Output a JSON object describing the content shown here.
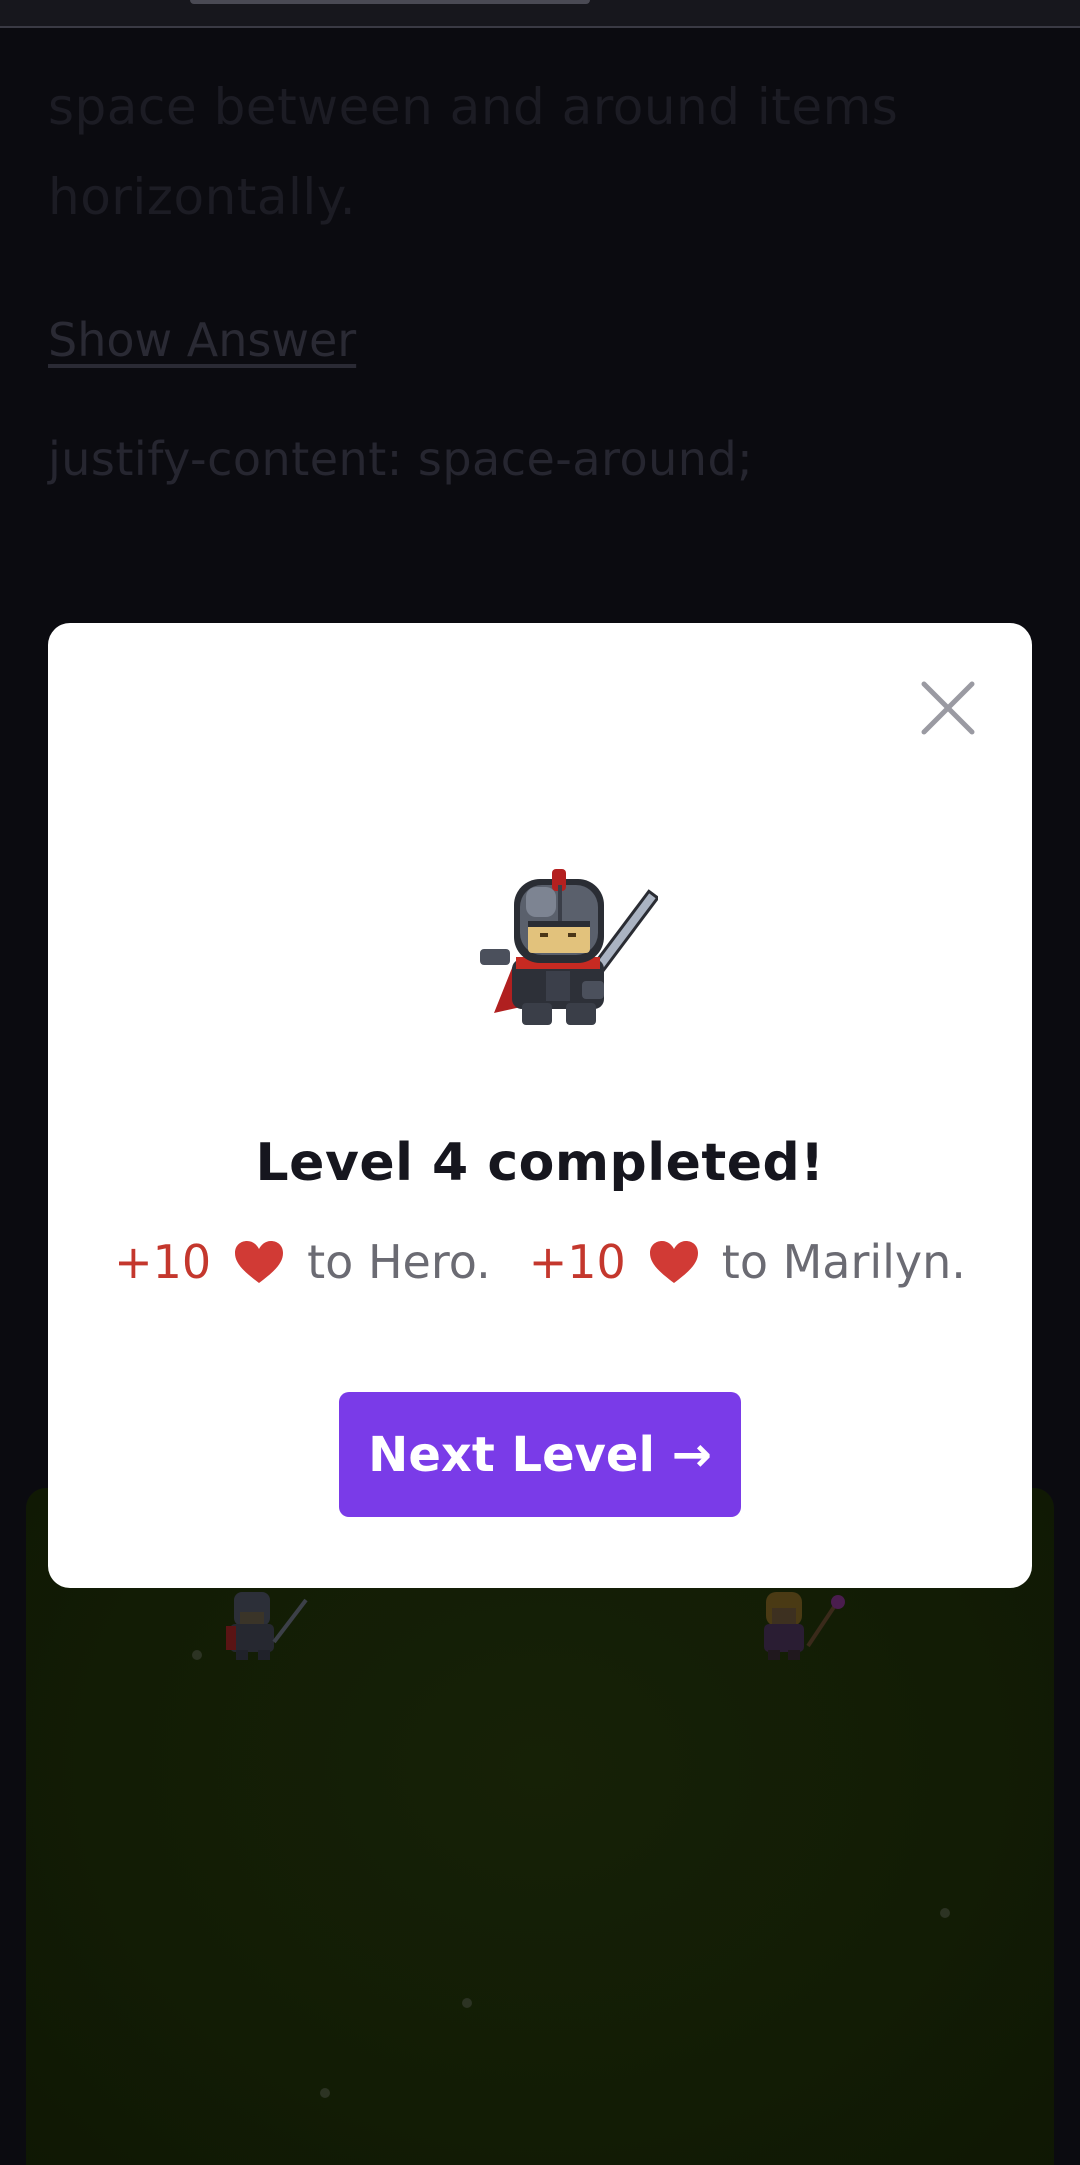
{
  "lesson": {
    "text": "space between and around items horizontally.",
    "show_answer_label": "Show Answer",
    "answer_code": "justify-content: space-around;"
  },
  "modal": {
    "title": "Level 4 completed!",
    "rewards": [
      {
        "amount": "+10",
        "icon": "heart-icon",
        "text": "to Hero."
      },
      {
        "amount": "+10",
        "icon": "heart-icon",
        "text": "to Marilyn."
      }
    ],
    "next_button_label": "Next Level →",
    "close_icon": "close-icon",
    "sprite": "knight-hero-sprite"
  },
  "colors": {
    "accent": "#7a3be8",
    "reward": "#c4372d",
    "heart": "#d13a35",
    "board": "#121c05"
  }
}
